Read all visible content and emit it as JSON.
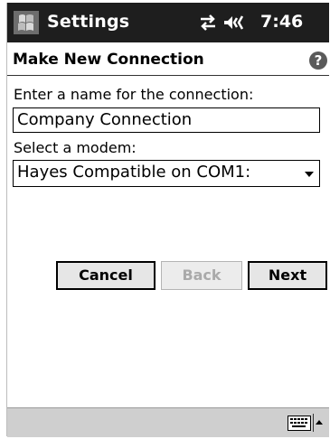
{
  "titlebar": {
    "app_title": "Settings",
    "clock": "7:46",
    "icons": [
      "start-menu-icon",
      "connectivity-icon",
      "speaker-icon"
    ]
  },
  "header": {
    "title": "Make New Connection",
    "help_icon": "?"
  },
  "form": {
    "name_label": "Enter a name for the connection:",
    "name_value": "Company Connection",
    "modem_label": "Select a modem:",
    "modem_value": "Hayes Compatible on COM1:"
  },
  "buttons": {
    "cancel": "Cancel",
    "back": "Back",
    "next": "Next"
  },
  "menubar": {
    "icons": [
      "keyboard-icon",
      "sip-arrow-icon"
    ]
  },
  "colors": {
    "titlebar_bg": "#1e1e1e",
    "menubar_bg": "#cfcfcf",
    "disabled_text": "#aaaaaa"
  }
}
